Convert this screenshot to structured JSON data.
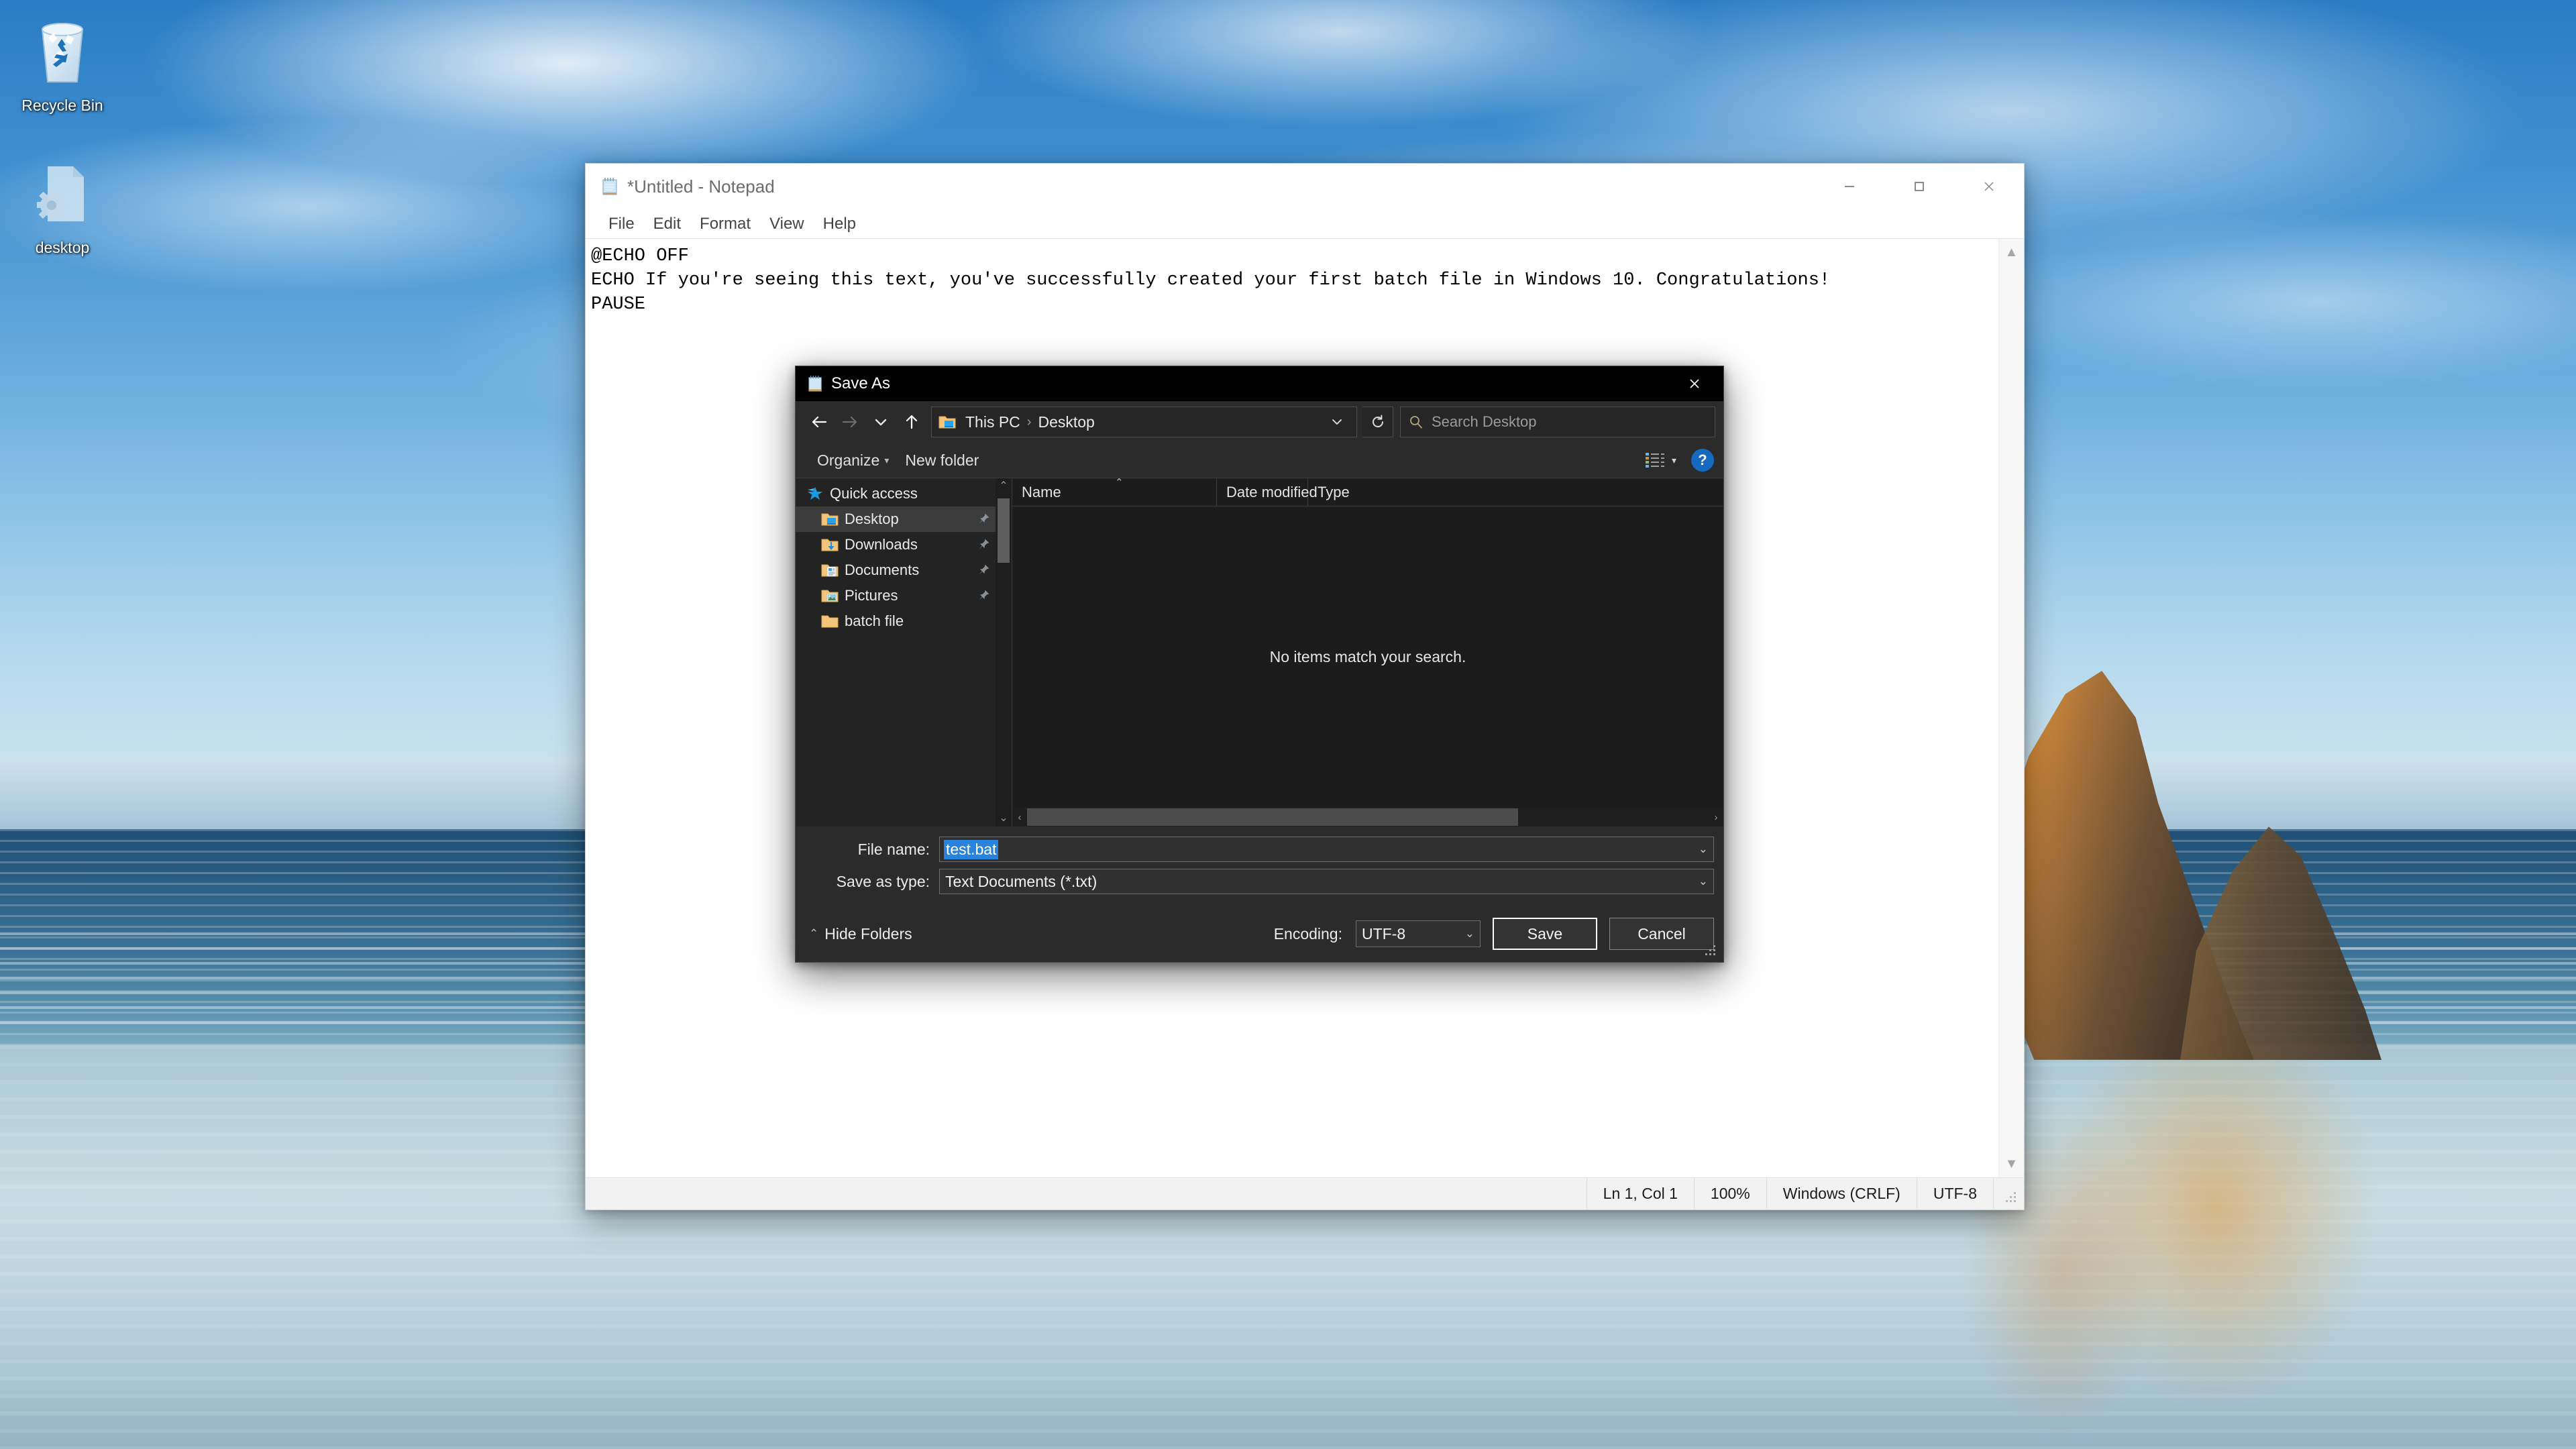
{
  "desktop": {
    "icons": [
      {
        "name": "Recycle Bin",
        "icon": "recycle-bin-icon"
      },
      {
        "name": "desktop",
        "icon": "config-file-icon"
      }
    ]
  },
  "notepad": {
    "title": "*Untitled - Notepad",
    "icon": "notepad-icon",
    "window_buttons": {
      "minimize": "—",
      "maximize": "□",
      "close": "✕"
    },
    "menus": [
      "File",
      "Edit",
      "Format",
      "View",
      "Help"
    ],
    "content": "@ECHO OFF\nECHO If you're seeing this text, you've successfully created your first batch file in Windows 10. Congratulations!\nPAUSE",
    "statusbar": {
      "position": "Ln 1, Col 1",
      "zoom": "100%",
      "line_ending": "Windows (CRLF)",
      "encoding": "UTF-8"
    }
  },
  "save_dialog": {
    "title": "Save As",
    "icon": "notepad-icon",
    "close_label": "✕",
    "nav": {
      "back": "←",
      "forward": "→",
      "recent": "⌄",
      "up": "↑",
      "refresh": "↻"
    },
    "breadcrumb": {
      "folder_icon": "desktop-folder-icon",
      "items": [
        "This PC",
        "Desktop"
      ],
      "separator": "›",
      "dropdown": "⌄"
    },
    "search": {
      "placeholder": "Search Desktop",
      "value": "",
      "icon": "search-icon"
    },
    "commandbar": {
      "organize": "Organize",
      "organize_caret": "▾",
      "new_folder": "New folder",
      "view_icon": "details-view-icon",
      "view_caret": "▾",
      "help": "?"
    },
    "navpane": {
      "items": [
        {
          "label": "Quick access",
          "icon": "star-icon",
          "pinned": false,
          "selected": false,
          "indent": false
        },
        {
          "label": "Desktop",
          "icon": "desktop-folder-icon",
          "pinned": true,
          "selected": true,
          "indent": true
        },
        {
          "label": "Downloads",
          "icon": "downloads-folder-icon",
          "pinned": true,
          "selected": false,
          "indent": true
        },
        {
          "label": "Documents",
          "icon": "documents-folder-icon",
          "pinned": true,
          "selected": false,
          "indent": true
        },
        {
          "label": "Pictures",
          "icon": "pictures-folder-icon",
          "pinned": true,
          "selected": false,
          "indent": true
        },
        {
          "label": "batch file",
          "icon": "folder-icon",
          "pinned": false,
          "selected": false,
          "indent": true
        }
      ],
      "scroll_up": "⌃",
      "scroll_down": "⌄"
    },
    "filelist": {
      "columns": [
        "Name",
        "Date modified",
        "Type"
      ],
      "sort_indicator": "⌃",
      "empty_message": "No items match your search.",
      "rows": [],
      "hscroll_left": "‹",
      "hscroll_right": "›"
    },
    "fields": {
      "filename_label": "File name:",
      "filename_value": "test.bat",
      "filename_selected": true,
      "filetype_label": "Save as type:",
      "filetype_value": "Text Documents (*.txt)",
      "caret": "⌄"
    },
    "bottom": {
      "hide_folders": "Hide Folders",
      "hide_folders_caret": "⌃",
      "encoding_label": "Encoding:",
      "encoding_value": "UTF-8",
      "encoding_caret": "⌄",
      "save": "Save",
      "cancel": "Cancel"
    }
  },
  "colors": {
    "accent": "#2a82da",
    "dialog_bg": "#2b2b2b",
    "dialog_titlebar": "#000000",
    "filepane_bg": "#1c1c1c",
    "help_blue": "#1569c0",
    "close_red": "#e81123"
  }
}
